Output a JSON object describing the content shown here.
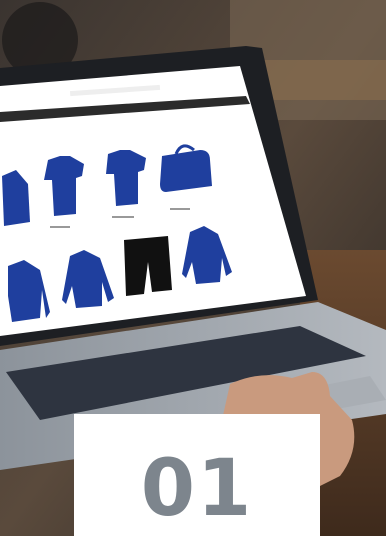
{
  "badge": {
    "number": "01"
  },
  "colors": {
    "badge_background": "#ffffff",
    "badge_text": "#7d858d",
    "screen_background": "#ffffff",
    "laptop_body": "#9a9fa6",
    "keyboard": "#2e3440",
    "product_blue": "#1f3f9e",
    "product_black": "#111111"
  },
  "icons": [
    "laptop",
    "polo-shirt",
    "t-shirt",
    "sports-bag",
    "zip-jacket",
    "shorts",
    "hand"
  ]
}
